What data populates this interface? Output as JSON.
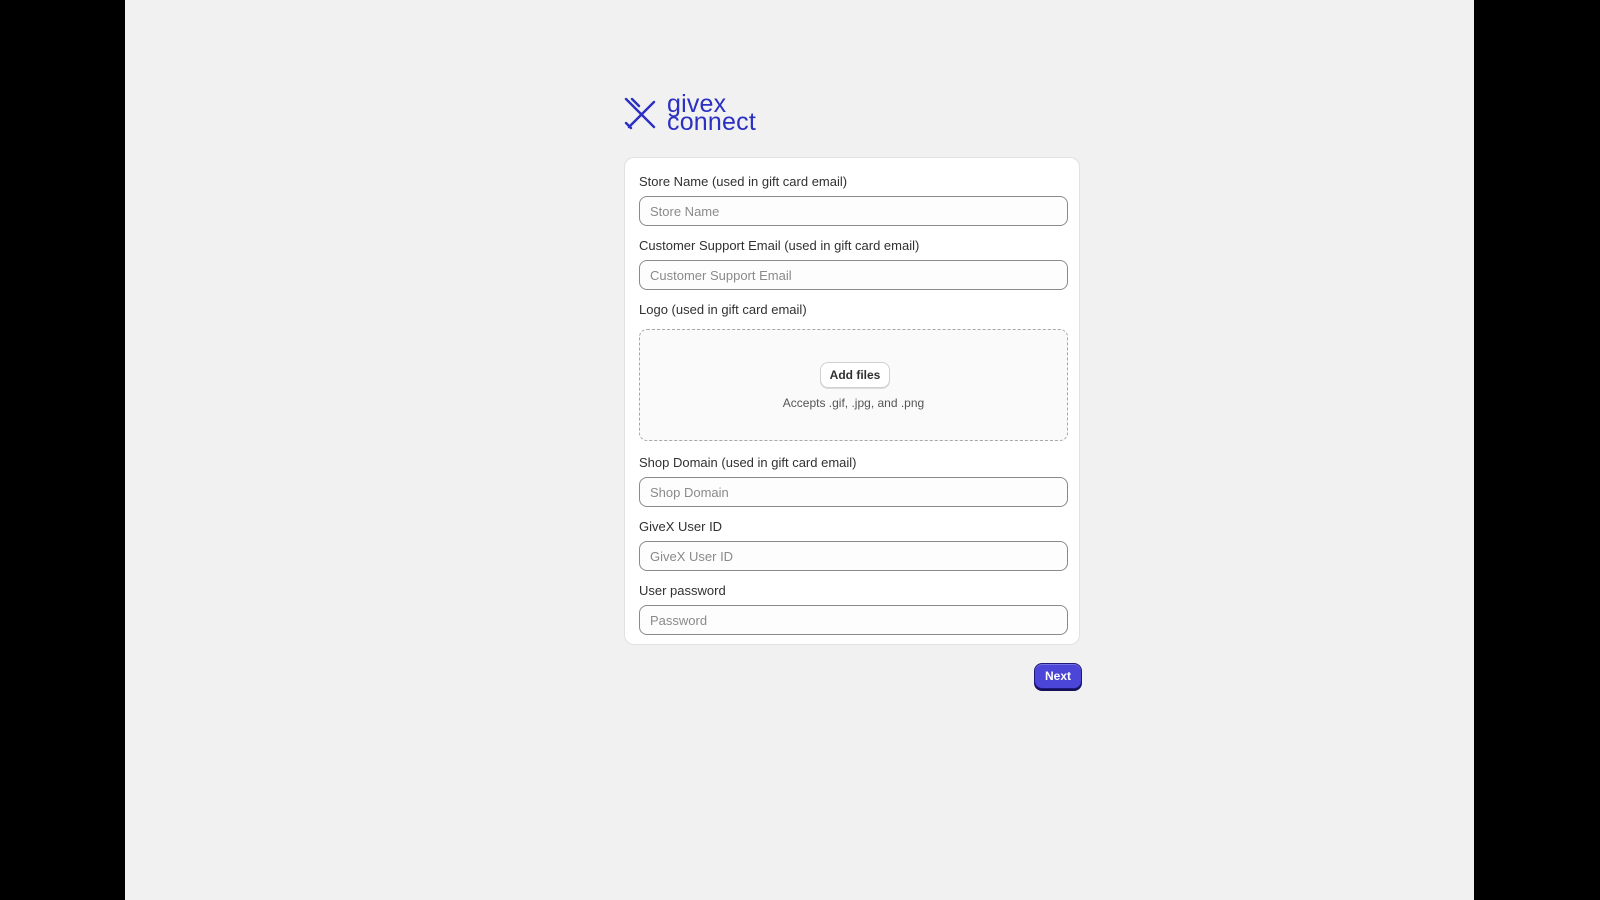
{
  "brand": {
    "line1": "givex",
    "line2": "connect",
    "color": "#2b2fc2",
    "icon": "givex-x-logo-icon"
  },
  "form": {
    "store_name": {
      "label": "Store Name (used in gift card email)",
      "placeholder": "Store Name"
    },
    "support_email": {
      "label": "Customer Support Email (used in gift card email)",
      "placeholder": "Customer Support Email"
    },
    "logo": {
      "label": "Logo (used in gift card email)",
      "button": "Add files",
      "hint": "Accepts .gif, .jpg, and .png"
    },
    "shop_domain": {
      "label": "Shop Domain (used in gift card email)",
      "placeholder": "Shop Domain"
    },
    "user_id": {
      "label": "GiveX User ID",
      "placeholder": "GiveX User ID"
    },
    "password": {
      "label": "User password",
      "placeholder": "Password"
    }
  },
  "actions": {
    "next_label": "Next",
    "accent_color": "#4b45d8"
  }
}
